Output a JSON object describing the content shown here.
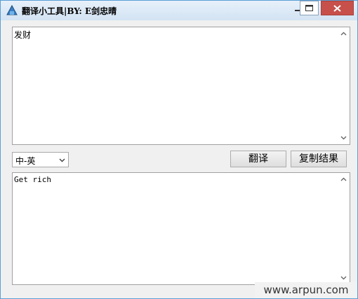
{
  "window": {
    "title": "翻译小工具|BY: E剑忠晴",
    "icon": "app-icon"
  },
  "input": {
    "value": "发财"
  },
  "language": {
    "selected": "中-英"
  },
  "buttons": {
    "translate_label": "翻译",
    "copy_label": "复制结果"
  },
  "output": {
    "value": "Get rich"
  },
  "watermark": {
    "text": "www.arpun.com"
  },
  "colors": {
    "close_button": "#c7504a",
    "window_border": "#5a9fd4"
  }
}
